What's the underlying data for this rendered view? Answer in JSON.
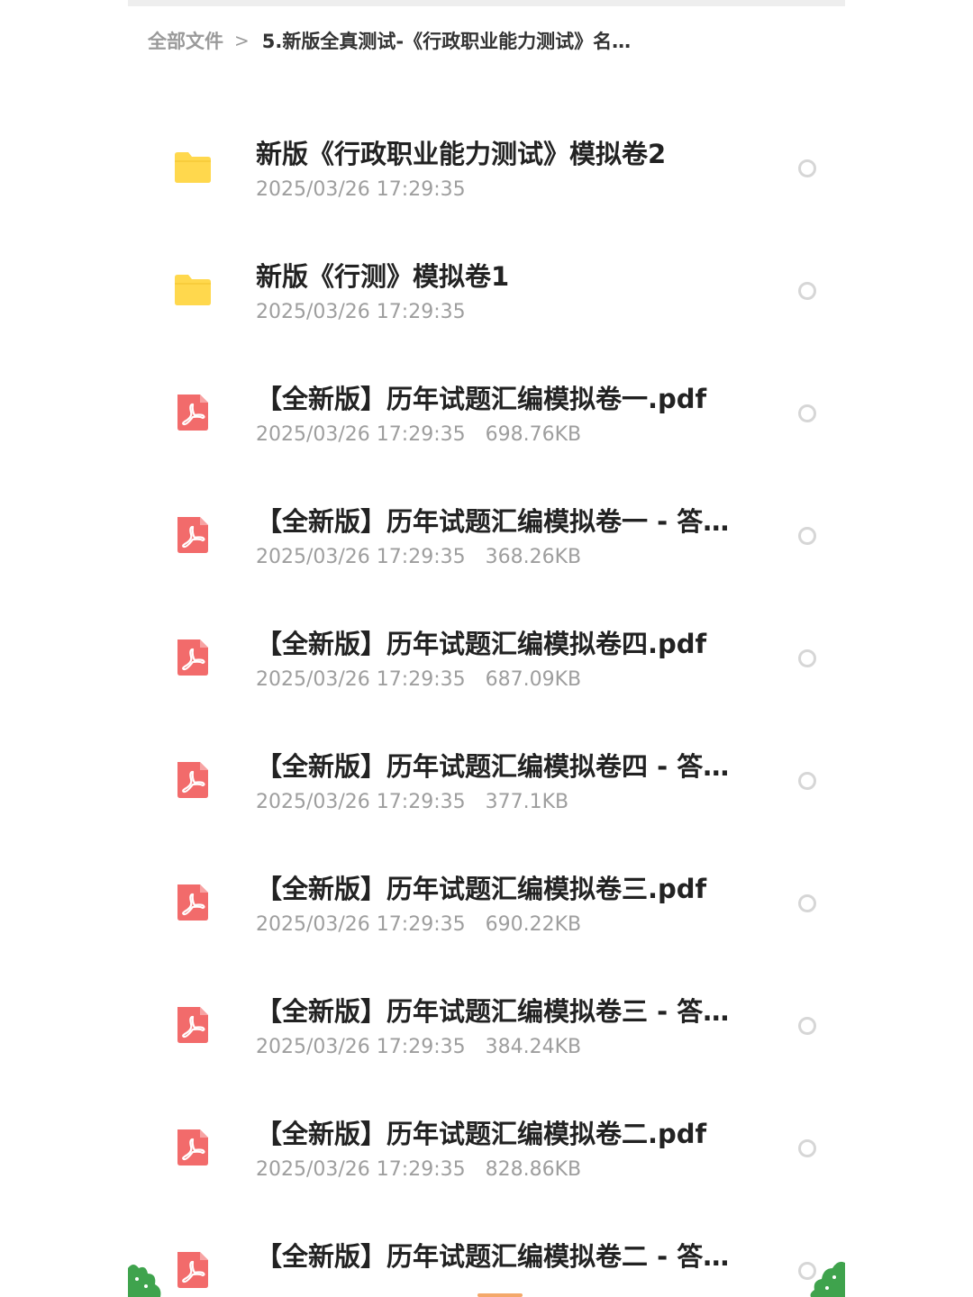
{
  "breadcrumb": {
    "root": "全部文件",
    "separator": ">",
    "current": "5.新版全真测试-《行政职业能力测试》名…"
  },
  "colors": {
    "folder": "#FFD84D",
    "pdf": "#F26B6B",
    "title": "#222222",
    "meta": "#9E9E9E",
    "radio_border": "#D6D6D6",
    "deco_green": "#3FA34D"
  },
  "files": [
    {
      "type": "folder",
      "icon": "folder-icon",
      "name": "新版《行政职业能力测试》模拟卷2",
      "date": "2025/03/26 17:29:35",
      "size": ""
    },
    {
      "type": "folder",
      "icon": "folder-icon",
      "name": "新版《行测》模拟卷1",
      "date": "2025/03/26 17:29:35",
      "size": ""
    },
    {
      "type": "pdf",
      "icon": "pdf-icon",
      "name": "【全新版】历年试题汇编模拟卷一.pdf",
      "date": "2025/03/26 17:29:35",
      "size": "698.76KB"
    },
    {
      "type": "pdf",
      "icon": "pdf-icon",
      "name": "【全新版】历年试题汇编模拟卷一 - 答…",
      "date": "2025/03/26 17:29:35",
      "size": "368.26KB"
    },
    {
      "type": "pdf",
      "icon": "pdf-icon",
      "name": "【全新版】历年试题汇编模拟卷四.pdf",
      "date": "2025/03/26 17:29:35",
      "size": "687.09KB"
    },
    {
      "type": "pdf",
      "icon": "pdf-icon",
      "name": "【全新版】历年试题汇编模拟卷四 - 答…",
      "date": "2025/03/26 17:29:35",
      "size": "377.1KB"
    },
    {
      "type": "pdf",
      "icon": "pdf-icon",
      "name": "【全新版】历年试题汇编模拟卷三.pdf",
      "date": "2025/03/26 17:29:35",
      "size": "690.22KB"
    },
    {
      "type": "pdf",
      "icon": "pdf-icon",
      "name": "【全新版】历年试题汇编模拟卷三 - 答…",
      "date": "2025/03/26 17:29:35",
      "size": "384.24KB"
    },
    {
      "type": "pdf",
      "icon": "pdf-icon",
      "name": "【全新版】历年试题汇编模拟卷二.pdf",
      "date": "2025/03/26 17:29:35",
      "size": "828.86KB"
    },
    {
      "type": "pdf",
      "icon": "pdf-icon",
      "name": "【全新版】历年试题汇编模拟卷二 - 答…",
      "date": "",
      "size": ""
    }
  ]
}
